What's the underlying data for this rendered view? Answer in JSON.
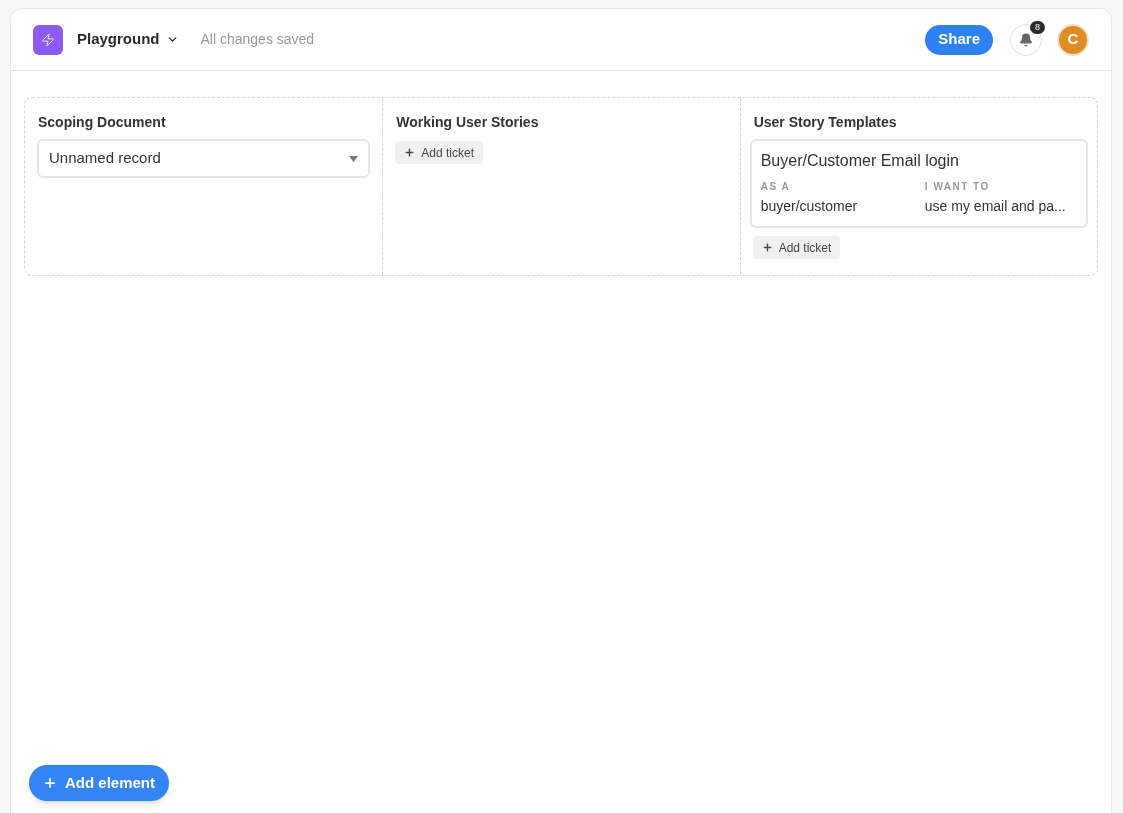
{
  "header": {
    "title": "Playground",
    "status": "All changes saved",
    "share_button": "Share",
    "notification_count": "8",
    "avatar_initial": "C"
  },
  "columns": [
    {
      "kind": "record",
      "title": "Scoping Document",
      "record": "Unnamed record"
    },
    {
      "kind": "tickets",
      "title": "Working User Stories",
      "add_button": "Add ticket"
    },
    {
      "kind": "tickets",
      "title": "User Story Templates",
      "tickets": [
        {
          "title": "Buyer/Customer Email login",
          "fields": [
            {
              "label": "AS A",
              "value": "buyer/customer"
            },
            {
              "label": "I WANT TO",
              "value": "use my email and pa..."
            }
          ]
        }
      ],
      "add_button": "Add ticket"
    }
  ],
  "add_element_button": "Add element"
}
